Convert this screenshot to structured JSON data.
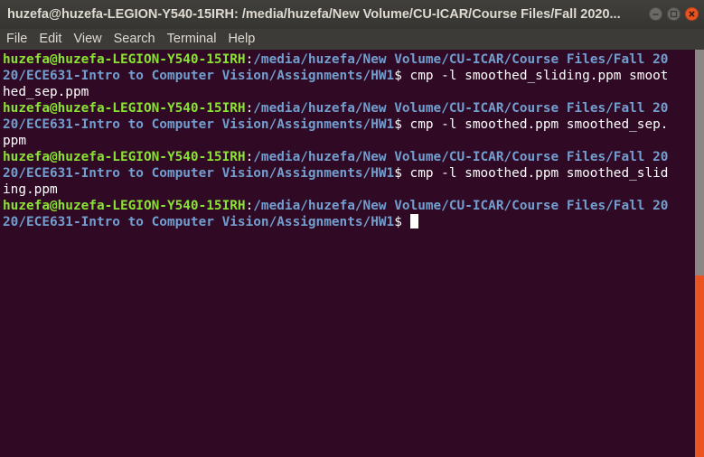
{
  "window": {
    "title": "huzefa@huzefa-LEGION-Y540-15IRH: /media/huzefa/New Volume/CU-ICAR/Course Files/Fall 2020..."
  },
  "menu": {
    "items": [
      "File",
      "Edit",
      "View",
      "Search",
      "Terminal",
      "Help"
    ]
  },
  "colors": {
    "background": "#300a24",
    "prompt_user": "#8ae234",
    "prompt_path": "#729fcf",
    "close_button": "#e95420"
  },
  "terminal": {
    "blocks": [
      {
        "l1_user": "huzefa@huzefa-LEGION-Y540-15IRH",
        "l1_colon": ":",
        "l1_path": "/media/huzefa/New Volume/CU-ICAR/Course Files/Fall 20",
        "l2_path": "20/ECE631-Intro to Computer Vision/Assignments/HW1",
        "l2_cmd": "$ cmp -l smoothed_sliding.ppm smoot",
        "l3_cmd": "hed_sep.ppm"
      },
      {
        "l1_user": "huzefa@huzefa-LEGION-Y540-15IRH",
        "l1_colon": ":",
        "l1_path": "/media/huzefa/New Volume/CU-ICAR/Course Files/Fall 20",
        "l2_path": "20/ECE631-Intro to Computer Vision/Assignments/HW1",
        "l2_cmd": "$ cmp -l smoothed.ppm smoothed_sep.",
        "l3_cmd": "ppm"
      },
      {
        "l1_user": "huzefa@huzefa-LEGION-Y540-15IRH",
        "l1_colon": ":",
        "l1_path": "/media/huzefa/New Volume/CU-ICAR/Course Files/Fall 20",
        "l2_path": "20/ECE631-Intro to Computer Vision/Assignments/HW1",
        "l2_cmd": "$ cmp -l smoothed.ppm smoothed_slid",
        "l3_cmd": "ing.ppm"
      },
      {
        "l1_user": "huzefa@huzefa-LEGION-Y540-15IRH",
        "l1_colon": ":",
        "l1_path": "/media/huzefa/New Volume/CU-ICAR/Course Files/Fall 20",
        "l2_path": "20/ECE631-Intro to Computer Vision/Assignments/HW1",
        "l2_cmd": "$ "
      }
    ]
  }
}
